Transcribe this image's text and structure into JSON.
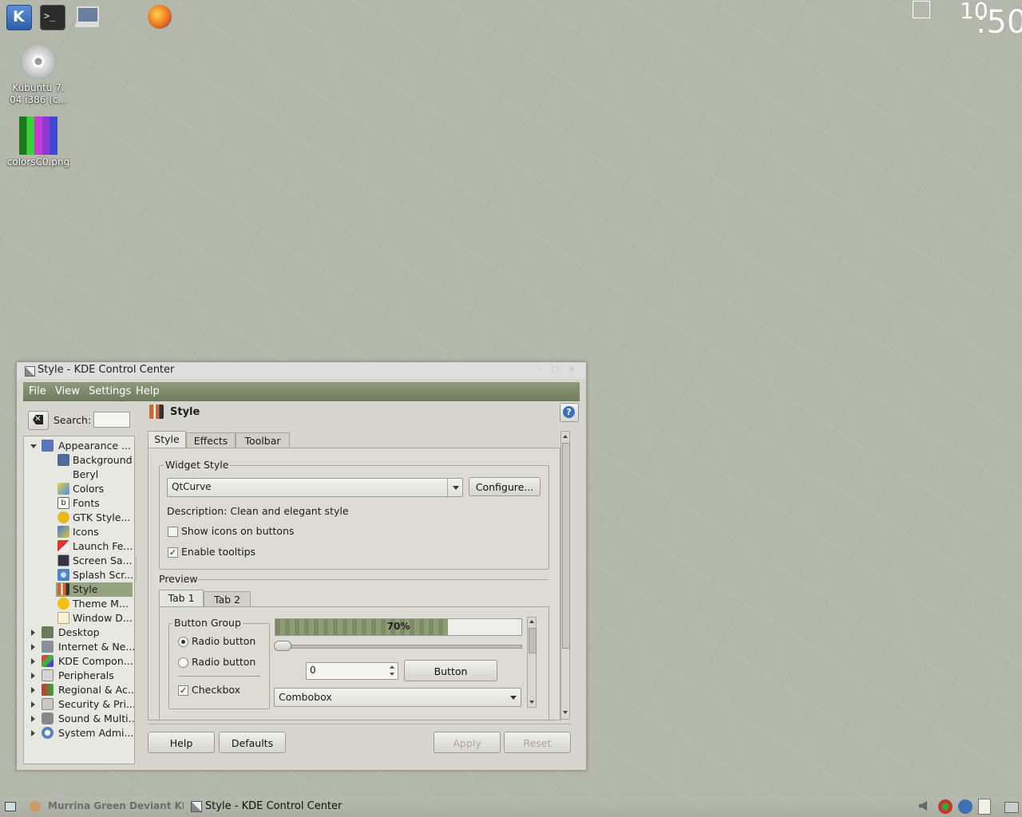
{
  "desktop": {
    "icons": [
      {
        "label": "Kubuntu 7.\n04 i386 (c..."
      },
      {
        "label": "colorsC0.png"
      }
    ],
    "clock": {
      "hours": "10",
      "minutes": ":50"
    }
  },
  "window": {
    "title": "Style - KDE Control Center",
    "menu": [
      "File",
      "View",
      "Settings",
      "Help"
    ],
    "search_label": "Search:",
    "search_value": "",
    "tree": {
      "appearance": {
        "label": "Appearance ...",
        "children": [
          "Background",
          "Beryl",
          "Colors",
          "Fonts",
          "GTK Style...",
          "Icons",
          "Launch Fe...",
          "Screen Sa...",
          "Splash Scr...",
          "Style",
          "Theme M...",
          "Window D..."
        ]
      },
      "categories": [
        "Desktop",
        "Internet & Ne...",
        "KDE Compon...",
        "Peripherals",
        "Regional & Ac...",
        "Security & Pri...",
        "Sound & Multi...",
        "System Admi..."
      ]
    },
    "module": {
      "title": "Style",
      "tabs": [
        "Style",
        "Effects",
        "Toolbar"
      ],
      "widget_style": {
        "group_title": "Widget Style",
        "combo_value": "QtCurve",
        "configure_label": "Configure...",
        "description": "Description: Clean and elegant style",
        "show_icons_label": "Show icons on buttons",
        "show_icons_checked": false,
        "enable_tooltips_label": "Enable tooltips",
        "enable_tooltips_checked": true
      },
      "preview": {
        "title": "Preview",
        "tabs": [
          "Tab 1",
          "Tab 2"
        ],
        "button_group_title": "Button Group",
        "radio1_label": "Radio button",
        "radio2_label": "Radio button",
        "checkbox_label": "Checkbox",
        "progress_text": "70%",
        "progress_fraction": 0.7,
        "spin_value": "0",
        "button_label": "Button",
        "combobox_value": "Combobox"
      }
    },
    "buttons": {
      "help": "Help",
      "defaults": "Defaults",
      "apply": "Apply",
      "reset": "Reset"
    }
  },
  "taskbar": {
    "tasks": [
      "Murrina Green Deviant KDE-",
      "Style - KDE Control Center"
    ]
  },
  "colors": {
    "menubar": "#7f8b6c",
    "selection": "#96a381",
    "desktop": "#b4b8ab"
  }
}
